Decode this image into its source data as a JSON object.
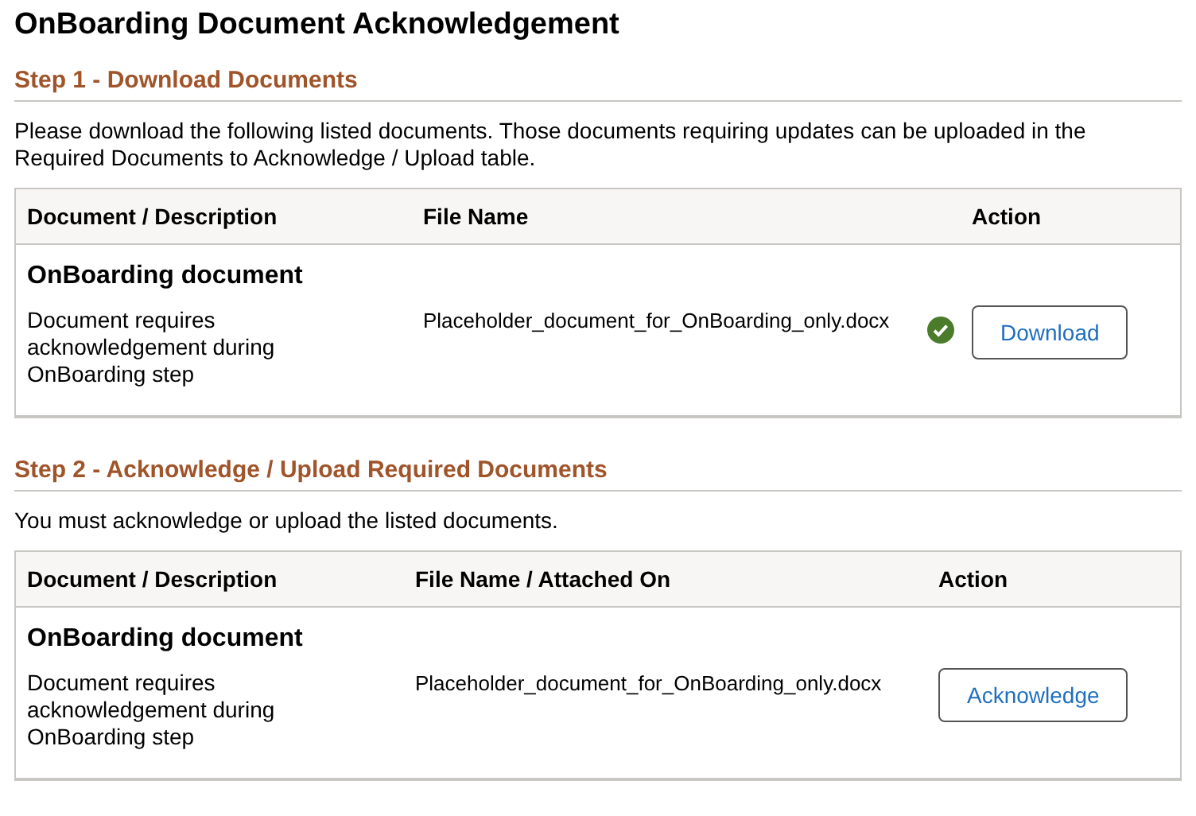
{
  "title": "OnBoarding Document Acknowledgement",
  "sections": [
    {
      "heading": "Step 1 - Download Documents",
      "intro": "Please download the following listed documents.  Those documents requiring updates can be uploaded in the Required Documents to Acknowledge / Upload table.",
      "columns": [
        "Document / Description",
        "File Name",
        "Action"
      ],
      "rows": [
        {
          "document": "OnBoarding document",
          "description": "Document requires acknowledgement during OnBoarding step",
          "file_name": "Placeholder_document_for_OnBoarding_only.docx",
          "downloaded": true,
          "action": "Download"
        }
      ]
    },
    {
      "heading": "Step 2 - Acknowledge / Upload Required Documents",
      "intro": "You must acknowledge or upload the listed documents.",
      "columns": [
        "Document / Description",
        "File Name / Attached On",
        "Action"
      ],
      "rows": [
        {
          "document": "OnBoarding document",
          "description": "Document requires acknowledgement during OnBoarding step",
          "file_name": "Placeholder_document_for_OnBoarding_only.docx",
          "downloaded": false,
          "action": "Acknowledge"
        }
      ]
    }
  ]
}
